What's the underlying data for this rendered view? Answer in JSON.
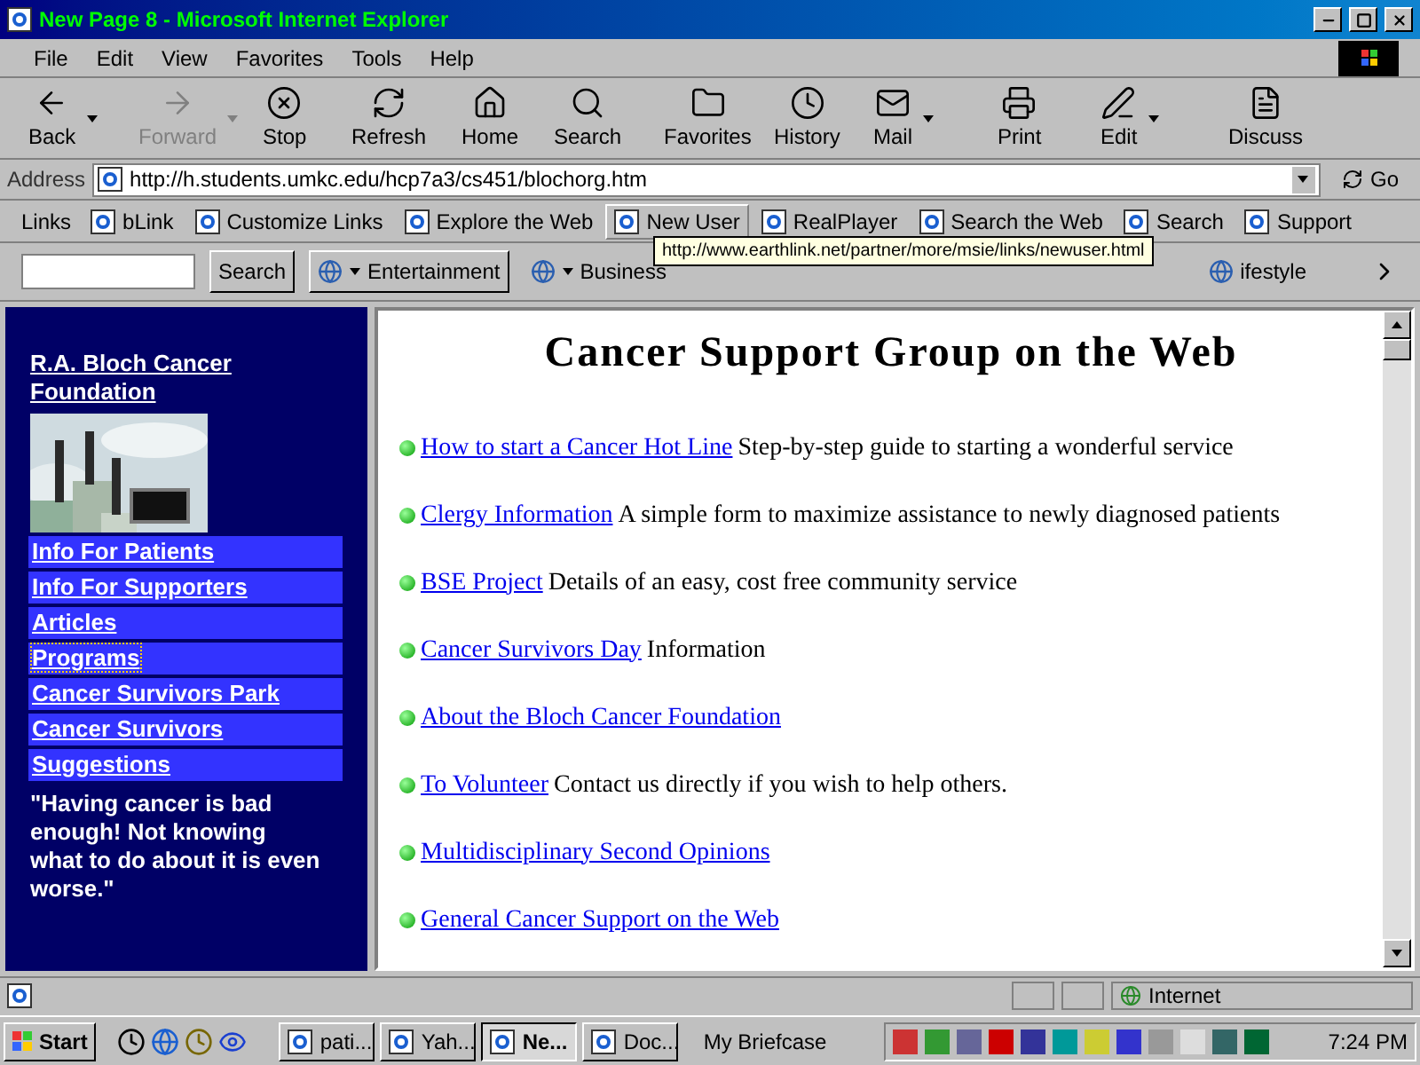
{
  "window": {
    "title": "New Page 8 - Microsoft Internet Explorer"
  },
  "menu": [
    "File",
    "Edit",
    "View",
    "Favorites",
    "Tools",
    "Help"
  ],
  "toolbar": [
    {
      "label": "Back",
      "disabled": false,
      "has_menu": true
    },
    {
      "label": "Forward",
      "disabled": true,
      "has_menu": true
    },
    {
      "label": "Stop",
      "disabled": false,
      "has_menu": false
    },
    {
      "label": "Refresh",
      "disabled": false,
      "has_menu": false
    },
    {
      "label": "Home",
      "disabled": false,
      "has_menu": false
    },
    {
      "label": "Search",
      "disabled": false,
      "has_menu": false
    },
    {
      "label": "Favorites",
      "disabled": false,
      "has_menu": false
    },
    {
      "label": "History",
      "disabled": false,
      "has_menu": false
    },
    {
      "label": "Mail",
      "disabled": false,
      "has_menu": true
    },
    {
      "label": "Print",
      "disabled": false,
      "has_menu": false
    },
    {
      "label": "Edit",
      "disabled": false,
      "has_menu": true
    },
    {
      "label": "Discuss",
      "disabled": false,
      "has_menu": false
    }
  ],
  "address": {
    "label": "Address",
    "value": "http://h.students.umkc.edu/hcp7a3/cs451/blochorg.htm",
    "go": "Go"
  },
  "links_bar": {
    "label": "Links",
    "items": [
      {
        "label": "bLink",
        "selected": false
      },
      {
        "label": "Customize Links",
        "selected": false
      },
      {
        "label": "Explore the Web",
        "selected": false
      },
      {
        "label": "New User",
        "selected": true
      },
      {
        "label": "RealPlayer",
        "selected": false
      },
      {
        "label": "Search the Web",
        "selected": false
      },
      {
        "label": "Search",
        "selected": false
      },
      {
        "label": "Support",
        "selected": false
      }
    ]
  },
  "search_bar": {
    "button": "Search",
    "channels": [
      "Entertainment",
      "Business"
    ],
    "last_channel": "ifestyle"
  },
  "tooltip": "http://www.earthlink.net/partner/more/msie/links/newuser.html",
  "sidebar": {
    "title": "R.A. Bloch Cancer Foundation",
    "items": [
      {
        "label": "Info For Patients",
        "focused": false
      },
      {
        "label": "Info For Supporters",
        "focused": false
      },
      {
        "label": "Articles",
        "focused": false
      },
      {
        "label": "Programs",
        "focused": true
      },
      {
        "label": "Cancer Survivors Park",
        "focused": false
      },
      {
        "label": "Cancer Survivors",
        "focused": false
      },
      {
        "label": "Suggestions",
        "focused": false
      }
    ],
    "quote": "\"Having cancer is bad enough! Not knowing what to do about it is even worse.\""
  },
  "main": {
    "heading": "Cancer Support Group on the Web",
    "items": [
      {
        "link": "How to start a Cancer Hot Line",
        "text": "Step-by-step guide to starting a wonderful service"
      },
      {
        "link": "Clergy Information",
        "text": "A simple form to maximize assistance to newly diagnosed patients"
      },
      {
        "link": "BSE Project",
        "text": "Details of an easy, cost free community service"
      },
      {
        "link": "Cancer Survivors Day",
        "text": "Information"
      },
      {
        "link": "About the Bloch Cancer Foundation"
      },
      {
        "link": "To Volunteer",
        "text": "Contact us directly if you wish to help others."
      },
      {
        "link": "Multidisciplinary Second Opinions"
      },
      {
        "link": "General Cancer Support on the Web"
      }
    ]
  },
  "status_bar": {
    "zone": "Internet"
  },
  "taskbar": {
    "start": "Start",
    "tasks": [
      {
        "label": "pati...",
        "selected": false
      },
      {
        "label": "Yah...",
        "selected": false
      },
      {
        "label": "Ne...",
        "selected": true
      },
      {
        "label": "Doc...",
        "selected": false
      }
    ],
    "briefcase": "My Briefcase",
    "clock": "7:24 PM"
  }
}
